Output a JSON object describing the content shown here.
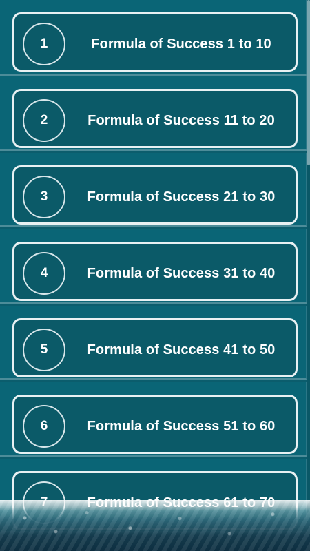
{
  "items": [
    {
      "number": "1",
      "label": "Formula of Success 1 to 10"
    },
    {
      "number": "2",
      "label": "Formula of Success 11 to 20"
    },
    {
      "number": "3",
      "label": "Formula of Success 21 to 30"
    },
    {
      "number": "4",
      "label": "Formula of Success 31 to 40"
    },
    {
      "number": "5",
      "label": "Formula of Success 41 to 50"
    },
    {
      "number": "6",
      "label": "Formula of Success 51 to 60"
    },
    {
      "number": "7",
      "label": "Formula of Success 61 to 70"
    }
  ],
  "colors": {
    "background": "#0b5d6d",
    "card": "#0b5a68",
    "border": "#e8f1f3",
    "text": "#ffffff"
  }
}
